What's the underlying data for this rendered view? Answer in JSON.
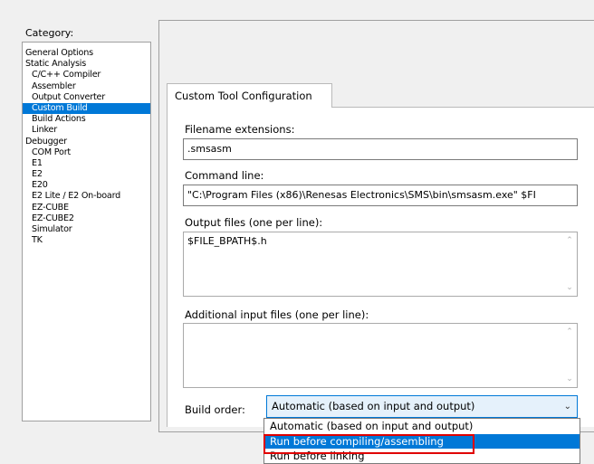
{
  "category": {
    "label": "Category:",
    "items": [
      {
        "label": "General Options",
        "indent": false,
        "selected": false
      },
      {
        "label": "Static Analysis",
        "indent": false,
        "selected": false
      },
      {
        "label": "C/C++ Compiler",
        "indent": true,
        "selected": false
      },
      {
        "label": "Assembler",
        "indent": true,
        "selected": false
      },
      {
        "label": "Output Converter",
        "indent": true,
        "selected": false
      },
      {
        "label": "Custom Build",
        "indent": true,
        "selected": true
      },
      {
        "label": "Build Actions",
        "indent": true,
        "selected": false
      },
      {
        "label": "Linker",
        "indent": true,
        "selected": false
      },
      {
        "label": "Debugger",
        "indent": false,
        "selected": false
      },
      {
        "label": "COM Port",
        "indent": true,
        "selected": false
      },
      {
        "label": "E1",
        "indent": true,
        "selected": false
      },
      {
        "label": "E2",
        "indent": true,
        "selected": false
      },
      {
        "label": "E20",
        "indent": true,
        "selected": false
      },
      {
        "label": "E2 Lite / E2 On-board",
        "indent": true,
        "selected": false
      },
      {
        "label": "EZ-CUBE",
        "indent": true,
        "selected": false
      },
      {
        "label": "EZ-CUBE2",
        "indent": true,
        "selected": false
      },
      {
        "label": "Simulator",
        "indent": true,
        "selected": false
      },
      {
        "label": "TK",
        "indent": true,
        "selected": false
      }
    ]
  },
  "tab": {
    "label": "Custom Tool Configuration"
  },
  "filename_extensions": {
    "label": "Filename extensions:",
    "value": ".smsasm"
  },
  "command_line": {
    "label": "Command line:",
    "value": "\"C:\\Program Files (x86)\\Renesas Electronics\\SMS\\bin\\smsasm.exe\" $FI"
  },
  "output_files": {
    "label": "Output files (one per line):",
    "value": "$FILE_BPATH$.h"
  },
  "additional_inputs": {
    "label": "Additional input files (one per line):",
    "value": ""
  },
  "build_order": {
    "label": "Build order:",
    "selected": "Automatic (based on input and output)",
    "options": [
      {
        "label": "Automatic (based on input and output)",
        "highlighted": false
      },
      {
        "label": "Run before compiling/assembling",
        "highlighted": true
      },
      {
        "label": "Run before linking",
        "highlighted": false
      }
    ]
  },
  "colors": {
    "selection": "#0078d7",
    "callout": "#e00000"
  }
}
